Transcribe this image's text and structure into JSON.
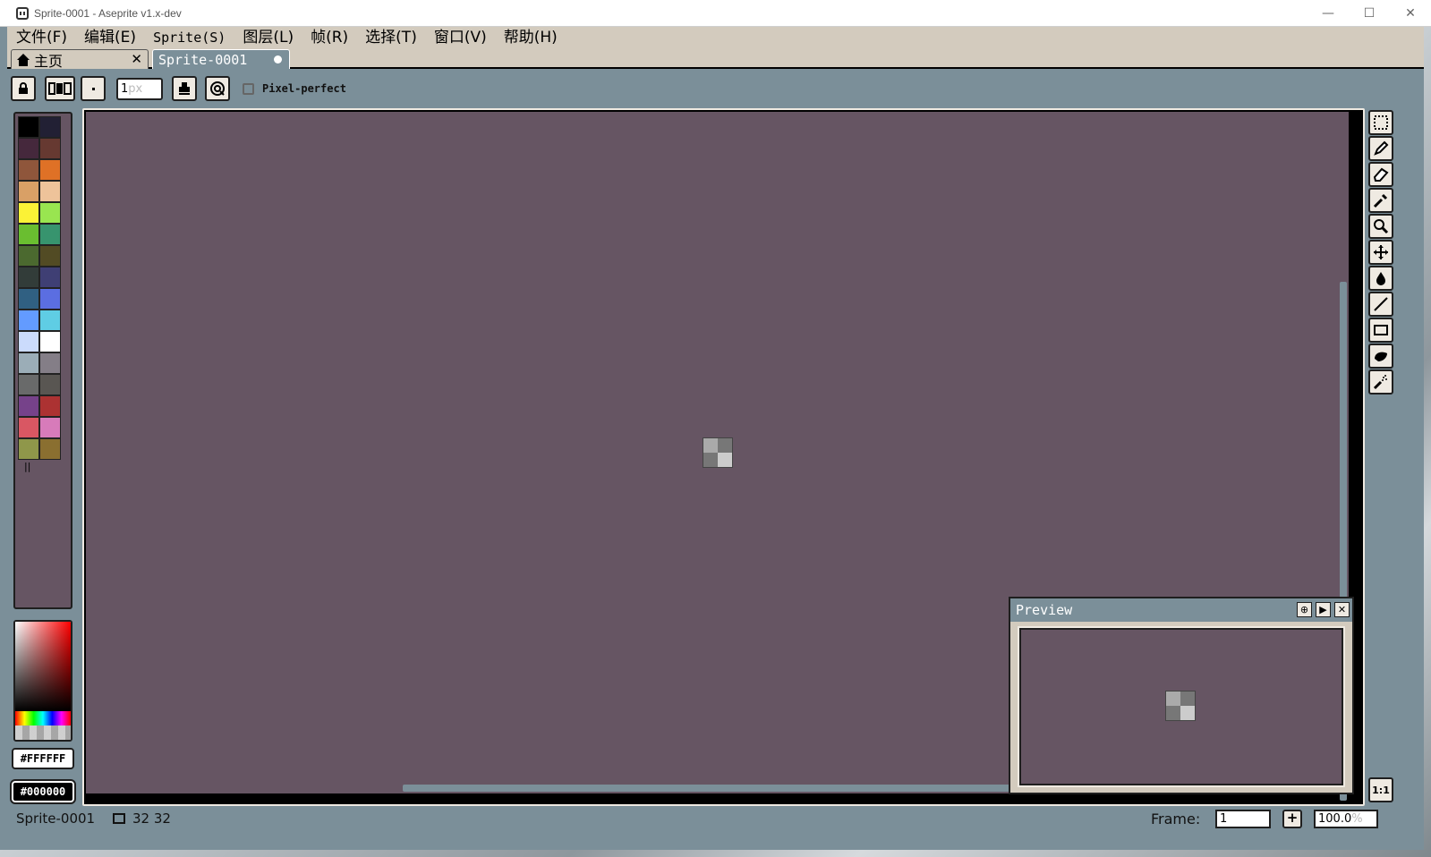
{
  "window": {
    "title": "Sprite-0001 - Aseprite v1.x-dev",
    "minimize": "—",
    "maximize": "☐",
    "close": "✕"
  },
  "menu": [
    "文件(F)",
    "编辑(E)",
    "Sprite(S)",
    "图层(L)",
    "帧(R)",
    "选择(T)",
    "窗口(V)",
    "帮助(H)"
  ],
  "tabs": {
    "home_label": "主页",
    "home_close": "✕",
    "sprite_label": "Sprite-0001"
  },
  "context_bar": {
    "brush_size_value": "1",
    "brush_size_unit": "px",
    "pixel_perfect_label": "Pixel-perfect",
    "pixel_perfect_checked": false
  },
  "palette": {
    "colors": [
      "#000000",
      "#222034",
      "#45283c",
      "#663931",
      "#8f563b",
      "#df7126",
      "#d9a066",
      "#eec39a",
      "#fbf236",
      "#99e550",
      "#6abe30",
      "#37946e",
      "#4b692f",
      "#524b24",
      "#323c39",
      "#3f3f74",
      "#306082",
      "#5b6ee1",
      "#639bff",
      "#5fcde4",
      "#cbdbfc",
      "#ffffff",
      "#9badb7",
      "#847e87",
      "#696a6a",
      "#595652",
      "#76428a",
      "#ac3232",
      "#d95763",
      "#d77bba",
      "#8f974a",
      "#8a6f30"
    ]
  },
  "colors": {
    "foreground": "#FFFFFF",
    "background": "#000000",
    "canvas_bg": "#665563",
    "ui_bg": "#7b8f99",
    "menu_bg": "#d3cbbe"
  },
  "preview": {
    "title": "Preview",
    "btn_center": "⊕",
    "btn_play": "▶",
    "btn_close": "✕"
  },
  "tools": [
    "marquee-icon",
    "pencil-icon",
    "eraser-icon",
    "eyedropper-icon",
    "zoom-icon",
    "move-icon",
    "paint-bucket-icon",
    "line-icon",
    "rectangle-icon",
    "contour-icon",
    "spray-icon"
  ],
  "zoom_one_to_one": "1:1",
  "status": {
    "sprite_name": "Sprite-0001",
    "sprite_size": "32 32",
    "frame_label": "Frame:",
    "frame_value": "1",
    "frame_plus": "+",
    "zoom_value": "100.0",
    "zoom_unit": "%"
  }
}
